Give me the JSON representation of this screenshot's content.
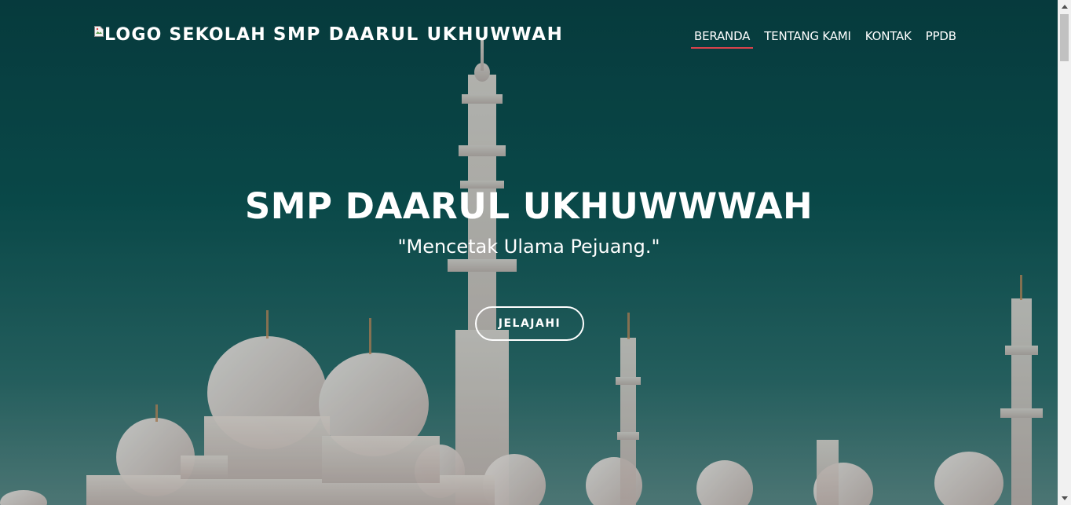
{
  "brand": {
    "logo_alt": "LOGO SEKOLAH",
    "name": "SMP DAARUL UKHUWWAH"
  },
  "nav": {
    "items": [
      {
        "label": "BERANDA",
        "active": true
      },
      {
        "label": "TENTANG KAMI",
        "active": false
      },
      {
        "label": "KONTAK",
        "active": false
      },
      {
        "label": "PPDB",
        "active": false
      }
    ]
  },
  "hero": {
    "title": "SMP DAARUL UKHUWWWAH",
    "tagline": "\"Mencetak Ulama Pejuang.\"",
    "cta_label": "JELAJAHI",
    "background_image": "mosque-domes-minarets"
  },
  "colors": {
    "overlay_teal": "#0c5050",
    "nav_active_underline": "#d9434c",
    "text": "#ffffff"
  }
}
